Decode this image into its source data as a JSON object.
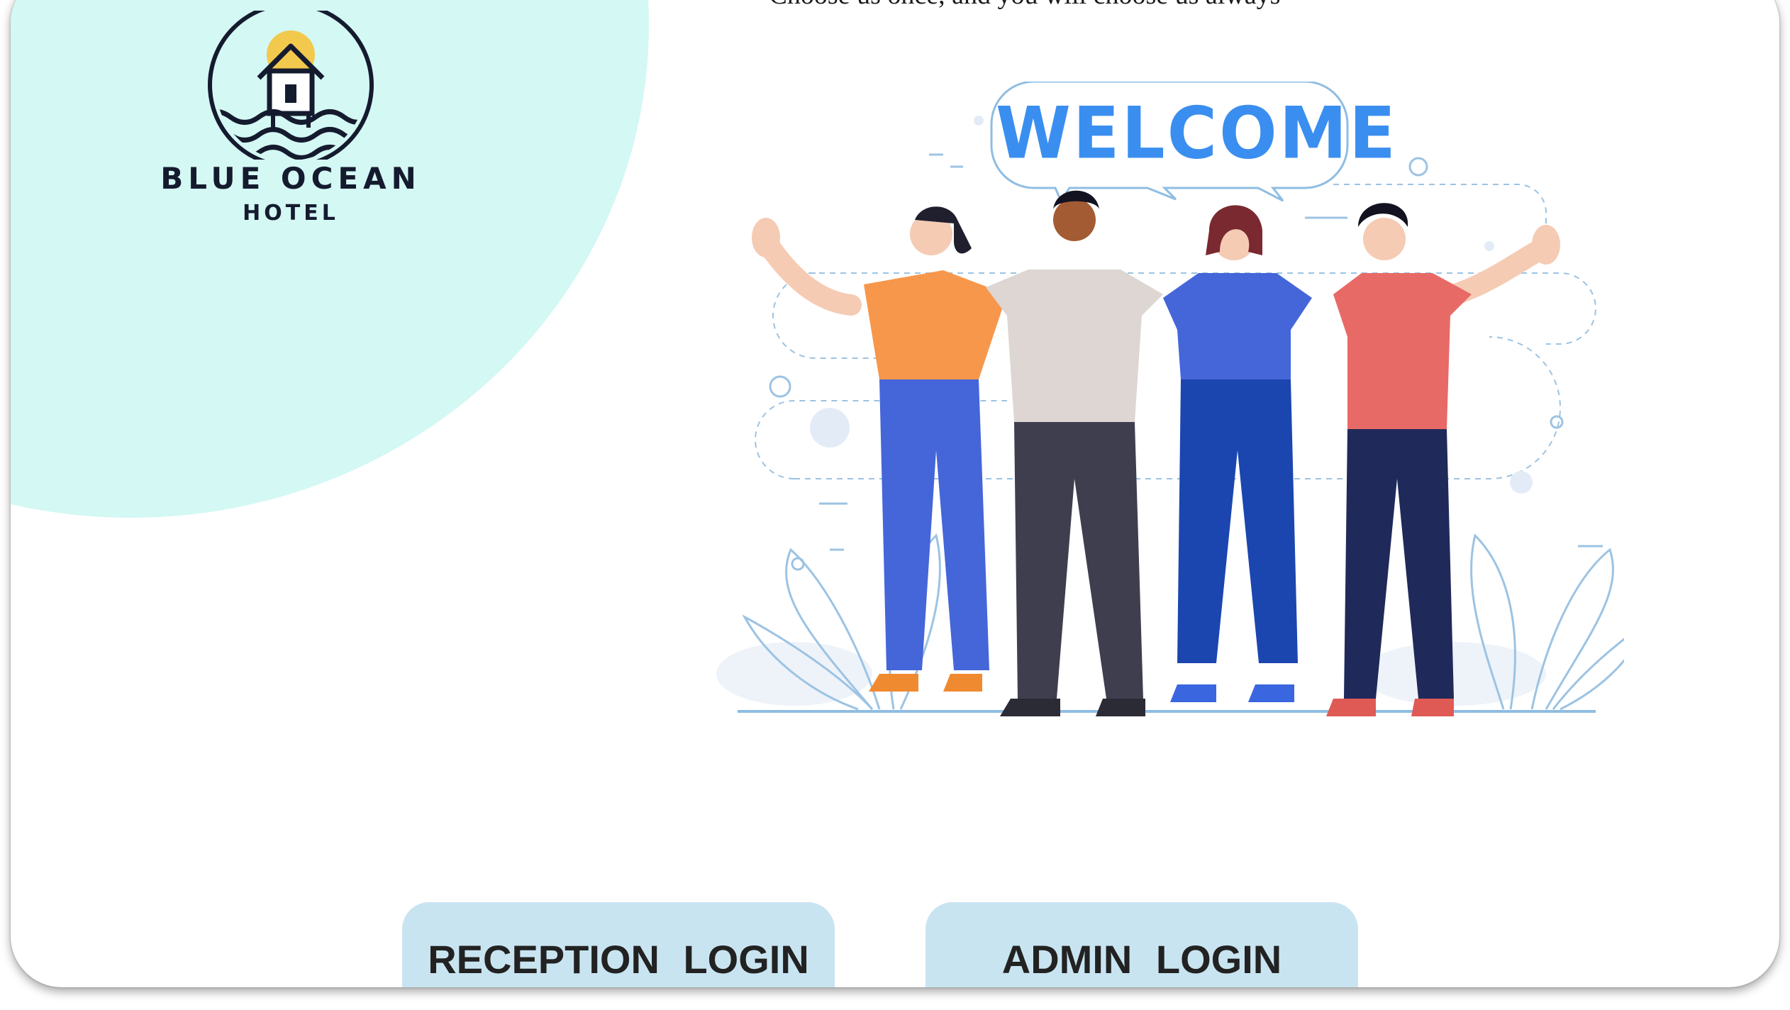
{
  "header": {
    "tagline": "Choose us once, and you will choose us always"
  },
  "logo": {
    "name": "BLUE OCEAN",
    "subtitle": "HOTEL"
  },
  "illustration": {
    "speech_bubble_text": "WELCOME"
  },
  "buttons": {
    "reception_login": "RECEPTION  LOGIN",
    "admin_login": "ADMIN LOGIN"
  },
  "colors": {
    "background": "#ffffff",
    "blob": "#d4f8f3",
    "button": "#c9e4f1",
    "button_text": "#222222",
    "welcome_text": "#3a8ef0",
    "logo_text": "#151b2f"
  }
}
